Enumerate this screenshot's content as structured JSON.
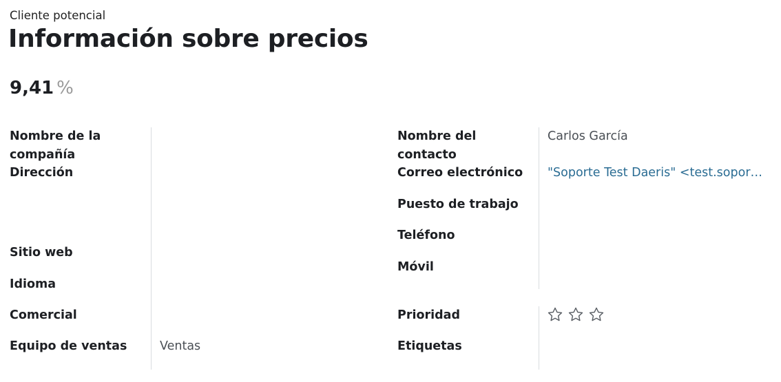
{
  "header": {
    "record_type": "Cliente potencial",
    "title": "Información sobre precios"
  },
  "probability": {
    "value": "9,41",
    "unit": "%"
  },
  "left": {
    "company_label": "Nombre de la compañía",
    "address_label": "Dirección",
    "website_label": "Sitio web",
    "language_label": "Idioma",
    "salesperson_label": "Comercial",
    "sales_team_label": "Equipo de ventas",
    "sales_team_value": "Ventas"
  },
  "right": {
    "contact_label": "Nombre del contacto",
    "contact_value": "Carlos García",
    "email_label": "Correo electrónico",
    "email_value": "\"Soporte Test Daeris\" <test.soporte@daeris.com>",
    "job_label": "Puesto de trabajo",
    "phone_label": "Teléfono",
    "mobile_label": "Móvil",
    "priority_label": "Prioridad",
    "priority_value": 0,
    "priority_max": 3,
    "tags_label": "Etiquetas"
  },
  "colors": {
    "link": "#2a6c93",
    "separator": "#d9dcdf",
    "star_outline": "#555a60"
  }
}
